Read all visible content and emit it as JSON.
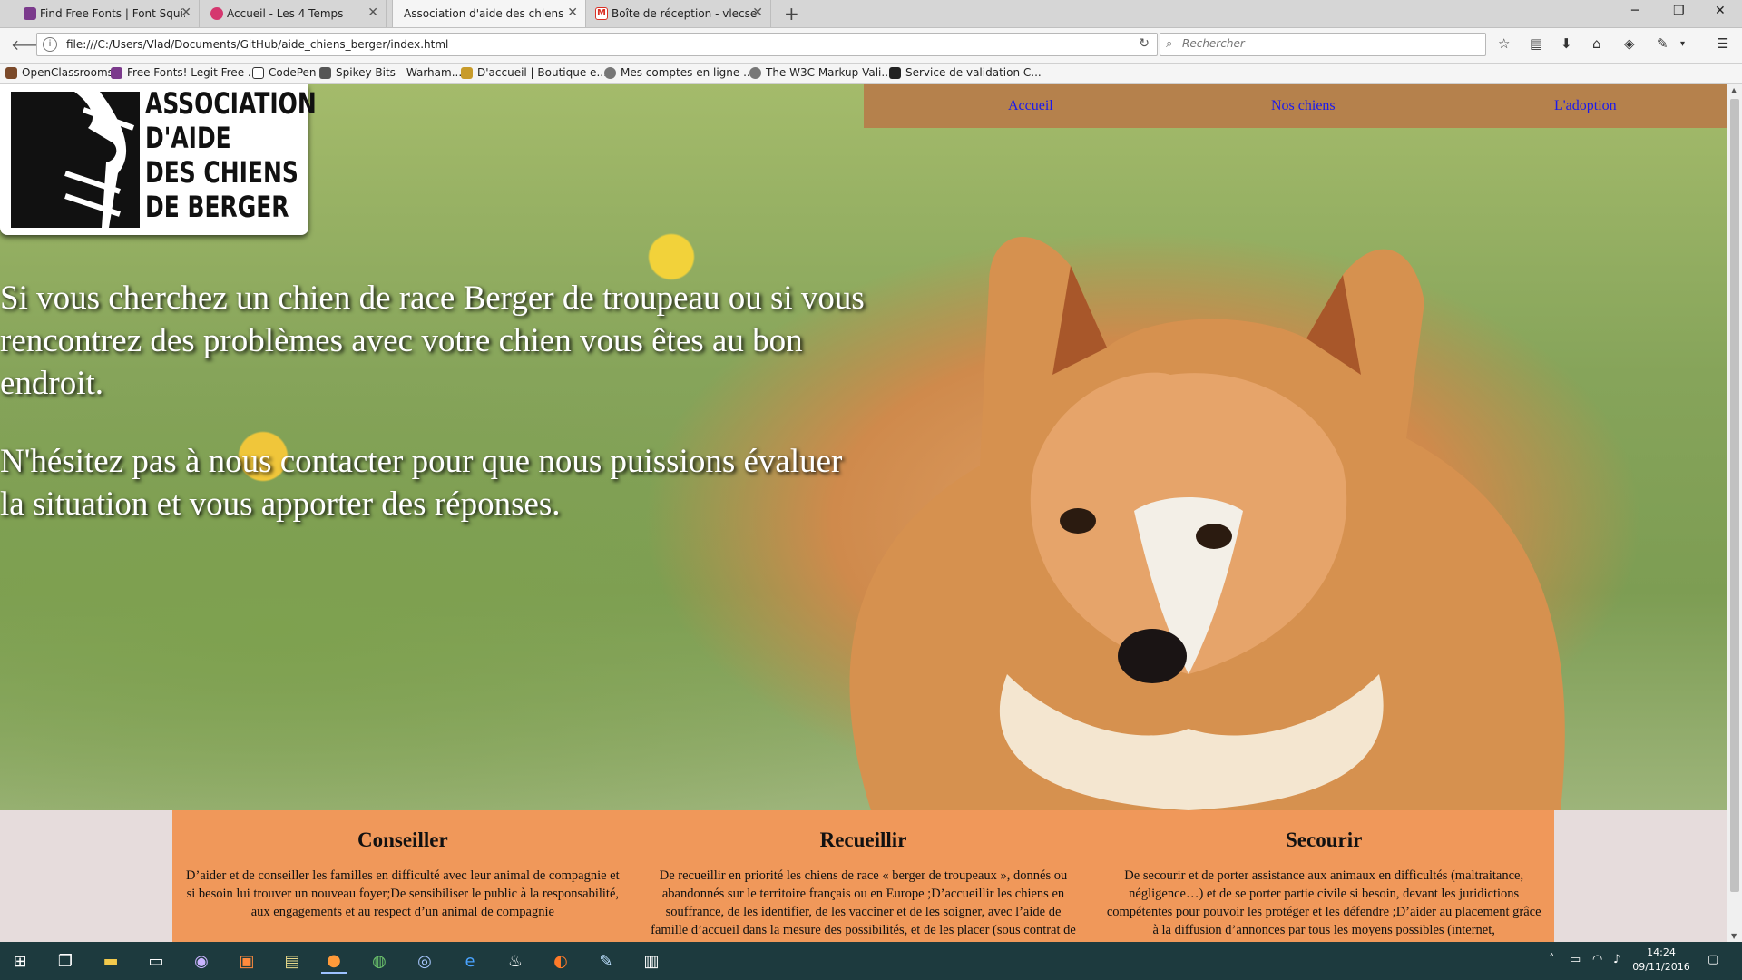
{
  "browser": {
    "tabs": [
      {
        "label": "Find Free Fonts | Font Squi...",
        "color": "#7b3a8c",
        "active": false
      },
      {
        "label": "Accueil - Les 4 Temps",
        "color": "#d5376f",
        "active": false
      },
      {
        "label": "Association d'aide des chiens ...",
        "color": "#e5e5e5",
        "active": true
      },
      {
        "label": "Boîte de réception - vlecse...",
        "color": "#d93025",
        "active": false
      }
    ],
    "url": "file:///C:/Users/Vlad/Documents/GitHub/aide_chiens_berger/index.html",
    "search_placeholder": "Rechercher",
    "bookmarks": [
      {
        "label": "OpenClassrooms",
        "color": "#7b4a2a"
      },
      {
        "label": "Free Fonts! Legit Free ...",
        "color": "#7b3a8c"
      },
      {
        "label": "CodePen",
        "color": "#333333"
      },
      {
        "label": "Spikey Bits - Warham...",
        "color": "#555555"
      },
      {
        "label": "D'accueil | Boutique e...",
        "color": "#c89b2a"
      },
      {
        "label": "Mes comptes en ligne ...",
        "color": "#777777"
      },
      {
        "label": "The W3C Markup Vali...",
        "color": "#777777"
      },
      {
        "label": "Service de validation C...",
        "color": "#222222"
      }
    ]
  },
  "site": {
    "logo_lines": [
      "ASSOCIATION",
      "D'AIDE",
      "DES CHIENS",
      "DE BERGER"
    ],
    "nav": [
      "Accueil",
      "Nos chiens",
      "L'adoption"
    ],
    "hero_paragraphs": [
      "Si vous cherchez un chien de race Berger de troupeau ou si vous rencontrez des problèmes avec votre chien vous êtes au bon endroit.",
      "N'hésitez pas à nous contacter pour que nous puissions évaluer la situation et vous apporter des réponses."
    ],
    "services": [
      {
        "title": "Conseiller",
        "text": "D’aider et de conseiller les familles en difficulté avec leur animal de compagnie et si besoin lui trouver un nouveau foyer;De sensibiliser le public à la responsabilité, aux engagements et au respect d’un animal de compagnie"
      },
      {
        "title": "Recueillir",
        "text": "De recueillir en priorité les chiens de race « berger de troupeaux », donnés ou abandonnés sur le territoire français ou en Europe ;D’accueillir les chiens en souffrance, de les identifier, de les vacciner et de les soigner, avec l’aide de famille d’accueil dans la mesure des possibilités, et de les placer (sous contrat de"
      },
      {
        "title": "Secourir",
        "text": "De secourir et de porter assistance aux animaux en difficultés (maltraitance, négligence…) et de se porter partie civile si besoin, devant les juridictions compétentes pour pouvoir les protéger et les défendre ;D’aider au placement grâce à la diffusion d’annonces par tous les moyens possibles (internet,"
      }
    ]
  },
  "taskbar": {
    "time": "14:24",
    "date": "09/11/2016"
  }
}
